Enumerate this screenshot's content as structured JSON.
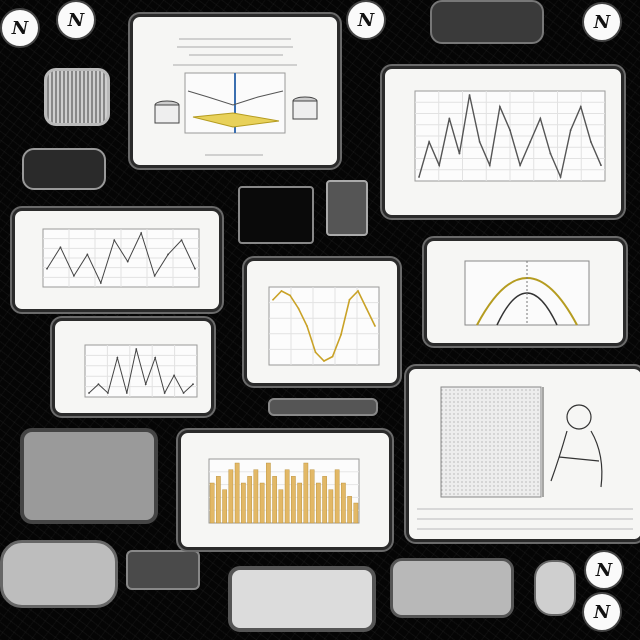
{
  "badges": [
    {
      "letter": "N"
    },
    {
      "letter": "N"
    },
    {
      "letter": "N"
    },
    {
      "letter": "N"
    },
    {
      "letter": "N"
    },
    {
      "letter": "N"
    }
  ],
  "charts": [
    {
      "id": "pitch-chart",
      "type": "line",
      "series": [
        {
          "values": [
            4,
            7,
            3,
            6,
            2,
            8,
            5,
            9,
            3,
            6,
            8,
            4
          ]
        }
      ]
    },
    {
      "id": "big-line",
      "type": "line",
      "series": [
        {
          "values": [
            2,
            5,
            3,
            7,
            4,
            9,
            5,
            3,
            8,
            6,
            3,
            5,
            7,
            4,
            2,
            6,
            8,
            5,
            3
          ]
        }
      ]
    },
    {
      "id": "yellow-curve",
      "type": "line",
      "series": [
        {
          "values": [
            8,
            9,
            8.5,
            7,
            5,
            2,
            1,
            1.5,
            4,
            8,
            9,
            7,
            5
          ]
        }
      ]
    },
    {
      "id": "small-line",
      "type": "line",
      "series": [
        {
          "values": [
            2,
            3,
            2,
            6,
            2,
            7,
            3,
            6,
            2,
            4,
            2,
            3
          ]
        }
      ]
    },
    {
      "id": "bar-chart",
      "type": "bar",
      "series": [
        {
          "values": [
            6,
            7,
            5,
            8,
            9,
            6,
            7,
            8,
            6,
            9,
            7,
            5,
            8,
            7,
            6,
            9,
            8,
            6,
            7,
            5,
            8,
            6,
            4,
            3
          ]
        }
      ]
    }
  ]
}
